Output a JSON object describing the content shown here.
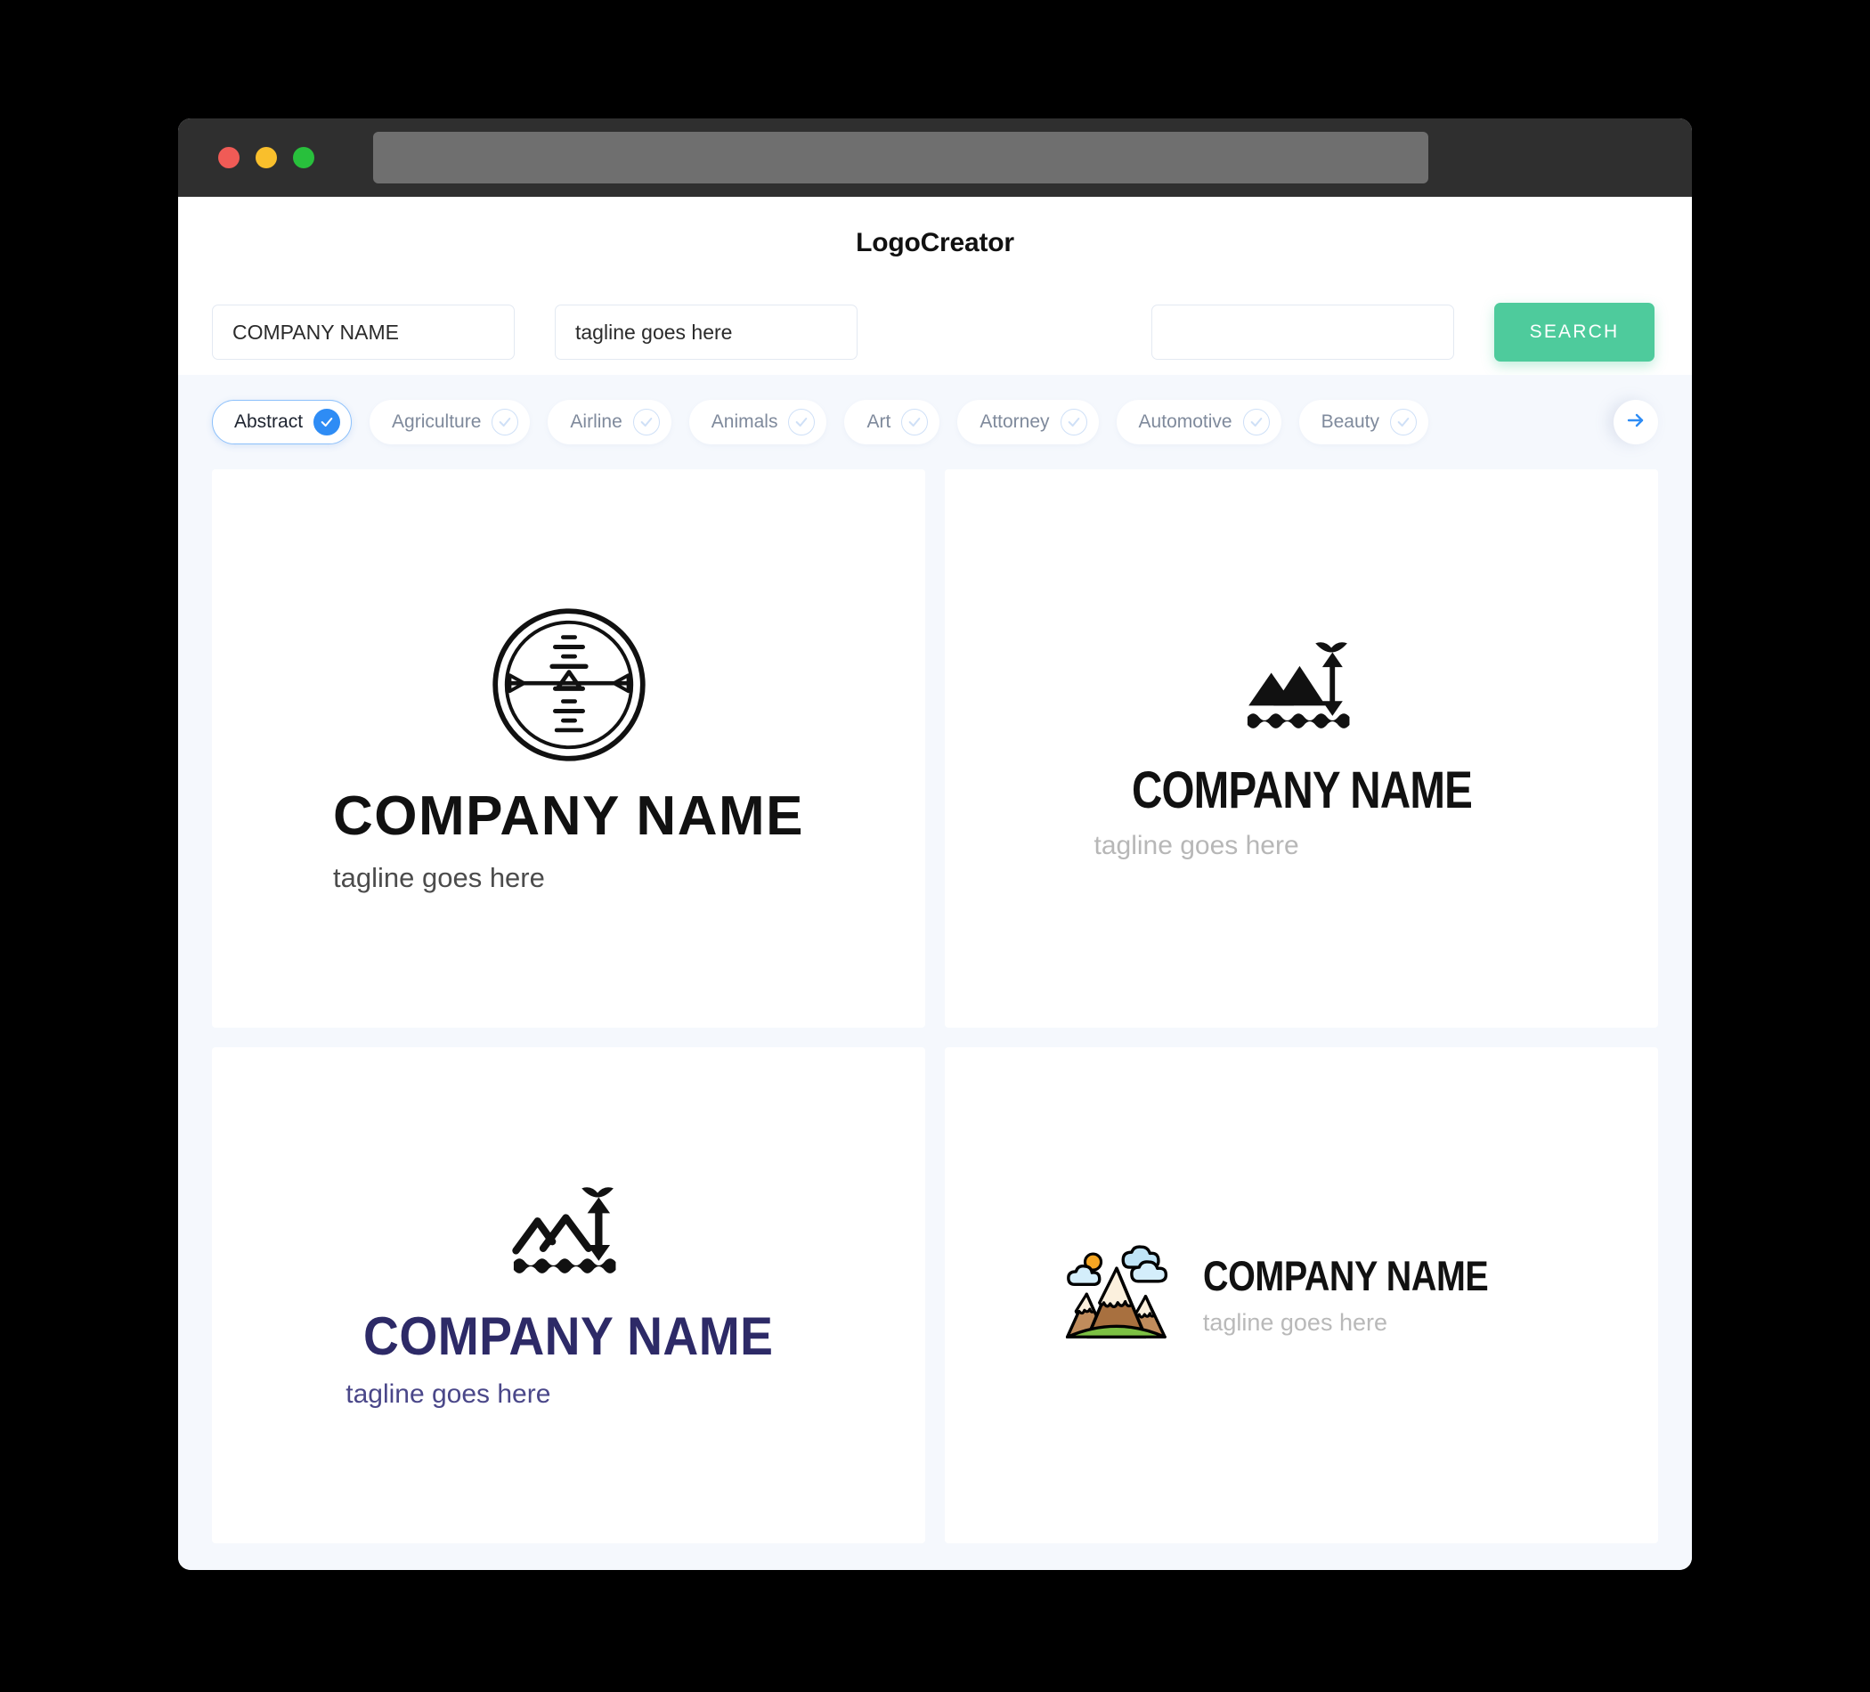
{
  "window": {
    "traffic_lights": [
      {
        "name": "close",
        "color": "#f05b56"
      },
      {
        "name": "minimize",
        "color": "#f9bf2c"
      },
      {
        "name": "maximize",
        "color": "#28c03c"
      }
    ],
    "url_value": ""
  },
  "header": {
    "app_title": "LogoCreator"
  },
  "search": {
    "company_value": "COMPANY NAME",
    "company_placeholder": "COMPANY NAME",
    "tagline_value": "tagline goes here",
    "tagline_placeholder": "tagline goes here",
    "extra_value": "",
    "extra_placeholder": "",
    "search_label": "SEARCH",
    "search_color": "#4ecb9c"
  },
  "categories": {
    "accent_color": "#2e8cf5",
    "next_icon": "arrow-right-icon",
    "items": [
      {
        "label": "Abstract",
        "selected": true
      },
      {
        "label": "Agriculture",
        "selected": false
      },
      {
        "label": "Airline",
        "selected": false
      },
      {
        "label": "Animals",
        "selected": false
      },
      {
        "label": "Art",
        "selected": false
      },
      {
        "label": "Attorney",
        "selected": false
      },
      {
        "label": "Automotive",
        "selected": false
      },
      {
        "label": "Beauty",
        "selected": false
      }
    ]
  },
  "results": {
    "cards": [
      {
        "icon": "circular-badge-abstract-icon",
        "name": "COMPANY NAME",
        "tagline": "tagline goes here",
        "name_color": "#111111",
        "tagline_color": "#4c4c4c",
        "layout": "stacked"
      },
      {
        "icon": "mountains-arrow-solid-icon",
        "name": "COMPANY NAME",
        "tagline": "tagline goes here",
        "name_color": "#111111",
        "tagline_color": "#b7b7b7",
        "layout": "stacked"
      },
      {
        "icon": "mountains-arrow-outline-icon",
        "name": "COMPANY NAME",
        "tagline": "tagline goes here",
        "name_color": "#2d2a67",
        "tagline_color": "#4a4789",
        "layout": "stacked"
      },
      {
        "icon": "mountain-scene-color-icon",
        "name": "COMPANY NAME",
        "tagline": "tagline goes here",
        "name_color": "#111111",
        "tagline_color": "#b9b9b9",
        "layout": "horizontal"
      }
    ]
  }
}
